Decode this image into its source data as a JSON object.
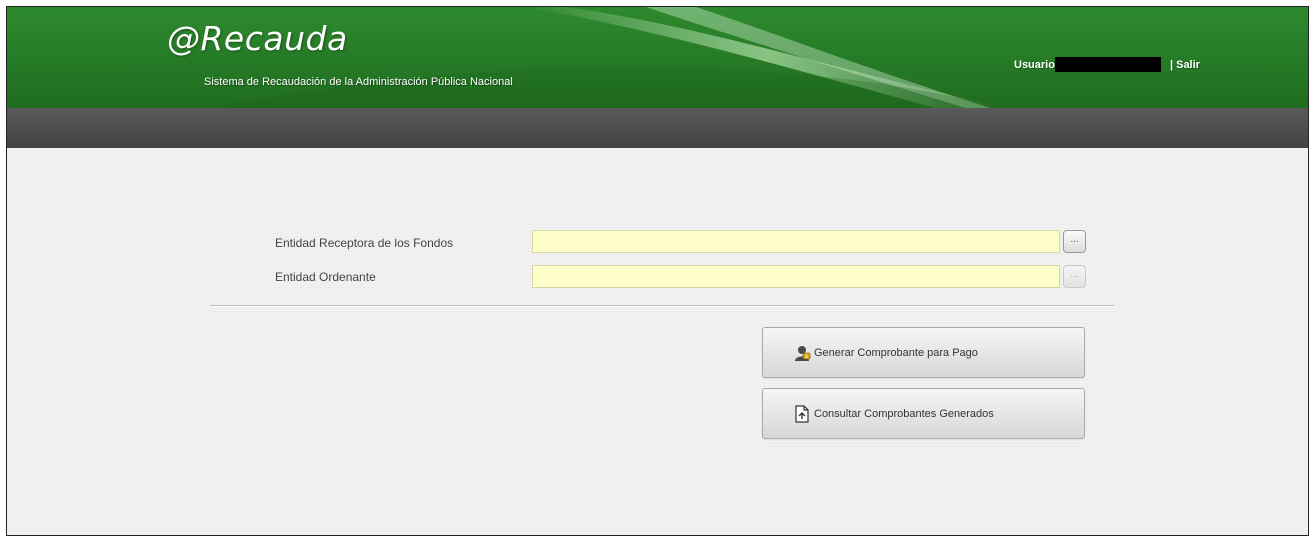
{
  "header": {
    "logo_text": "@Recauda",
    "subtitle": "Sistema de Recaudación de la Administración Pública Nacional",
    "user_label": "Usuario",
    "logout_label": "| Salir"
  },
  "form": {
    "fields": [
      {
        "label": "Entidad Receptora de los Fondos",
        "value": "",
        "lookup_label": "...",
        "lookup_enabled": true
      },
      {
        "label": "Entidad Ordenante",
        "value": "",
        "lookup_label": "...",
        "lookup_enabled": false
      }
    ]
  },
  "actions": {
    "generate_label": "Generar Comprobante para Pago",
    "generate_icon": "payment-user-icon",
    "consult_label": "Consultar Comprobantes Generados",
    "consult_icon": "document-icon"
  },
  "colors": {
    "header_green": "#2e8a2e",
    "navbar_gray": "#4d4d4d",
    "input_bg": "#fefec9"
  }
}
